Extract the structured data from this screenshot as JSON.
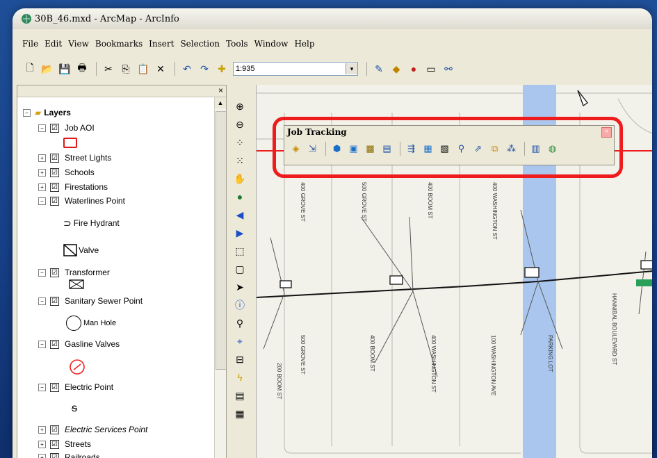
{
  "window": {
    "title": "30B_46.mxd - ArcMap - ArcInfo"
  },
  "menu": [
    "File",
    "Edit",
    "View",
    "Bookmarks",
    "Insert",
    "Selection",
    "Tools",
    "Window",
    "Help"
  ],
  "toolbar": {
    "scale_value": "1:935",
    "scale_dropdown_icon": "▾"
  },
  "toc": {
    "close_label": "×",
    "root_label": "Layers",
    "layers": [
      {
        "label": "Job AOI",
        "expander": "−",
        "checked": "☑"
      },
      {
        "label": "Street Lights",
        "expander": "+",
        "checked": "☑"
      },
      {
        "label": "Schools",
        "expander": "+",
        "checked": "☑"
      },
      {
        "label": "Firestations",
        "expander": "+",
        "checked": "☑"
      },
      {
        "label": "Waterlines Point",
        "expander": "−",
        "checked": "☑"
      },
      {
        "label": "Transformer",
        "expander": "−",
        "checked": "☑"
      },
      {
        "label": "Sanitary Sewer Point",
        "expander": "−",
        "checked": "☑"
      },
      {
        "label": "Gasline Valves",
        "expander": "−",
        "checked": "☑"
      },
      {
        "label": "Electric Point",
        "expander": "−",
        "checked": "☑"
      },
      {
        "label": "Electric Services Point",
        "expander": "+",
        "checked": "☑"
      },
      {
        "label": "Streets",
        "expander": "+",
        "checked": "☑"
      },
      {
        "label": "Railroads",
        "expander": "+",
        "checked": "☑"
      }
    ],
    "legend": {
      "fire_hydrant": "Fire Hydrant",
      "valve": "Valve",
      "man_hole": "Man Hole"
    }
  },
  "job_tracking": {
    "title": "Job Tracking",
    "close_label": "×"
  },
  "map": {
    "street_labels": [
      "400 GROVE ST",
      "500 GROVE ST",
      "400 BOOM ST",
      "400 WASHINGTON ST",
      "500 GROVE ST",
      "400 BOOM ST",
      "400 WASHINGTON ST",
      "200 BOOM ST",
      "100 WASHINGTON AVE",
      "PARKING LOT",
      "HANNIBAL BOULEVARD ST"
    ]
  },
  "colors": {
    "highlight": "#ee1c1c",
    "water": "#aac6ee",
    "background": "#1f4f98"
  }
}
